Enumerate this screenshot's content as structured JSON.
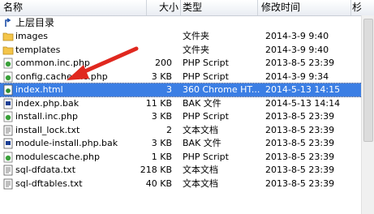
{
  "header": {
    "name": "名称",
    "size": "大小",
    "type": "类型",
    "modified": "修改时间",
    "extra": "杉"
  },
  "up_label": "上层目录",
  "files": [
    {
      "name": "images",
      "size": "",
      "type": "文件夹",
      "modified": "2014-3-9 9:40",
      "icon": "folder-icon"
    },
    {
      "name": "templates",
      "size": "",
      "type": "文件夹",
      "modified": "2014-3-9 9:40",
      "icon": "folder-icon"
    },
    {
      "name": "common.inc.php",
      "size": "200",
      "type": "PHP Script",
      "modified": "2013-8-5 23:39",
      "icon": "php-file-icon"
    },
    {
      "name": "config.cache.inc.php",
      "size": "3 KB",
      "type": "PHP Script",
      "modified": "2014-3-9 9:34",
      "icon": "php-file-icon"
    },
    {
      "name": "index.html",
      "size": "3",
      "type": "360 Chrome HT...",
      "modified": "2014-5-13 14:15",
      "icon": "html-file-icon",
      "selected": true
    },
    {
      "name": "index.php.bak",
      "size": "11 KB",
      "type": "BAK 文件",
      "modified": "2014-5-13 14:14",
      "icon": "bak-file-icon"
    },
    {
      "name": "install.inc.php",
      "size": "3 KB",
      "type": "PHP Script",
      "modified": "2013-8-5 23:39",
      "icon": "php-file-icon"
    },
    {
      "name": "install_lock.txt",
      "size": "2",
      "type": "文本文档",
      "modified": "2013-8-5 23:39",
      "icon": "text-file-icon"
    },
    {
      "name": "module-install.php.bak",
      "size": "3 KB",
      "type": "BAK 文件",
      "modified": "2013-8-5 23:39",
      "icon": "bak-file-icon"
    },
    {
      "name": "modulescache.php",
      "size": "1 KB",
      "type": "PHP Script",
      "modified": "2013-8-5 23:39",
      "icon": "php-file-icon"
    },
    {
      "name": "sql-dfdata.txt",
      "size": "218 KB",
      "type": "文本文档",
      "modified": "2013-8-5 23:39",
      "icon": "text-file-icon"
    },
    {
      "name": "sql-dftables.txt",
      "size": "40 KB",
      "type": "文本文档",
      "modified": "2013-8-5 23:39",
      "icon": "text-file-icon"
    }
  ],
  "colors": {
    "selection": "#3b7ee4",
    "arrow": "#e0281f",
    "folder": "#f4c54a"
  }
}
